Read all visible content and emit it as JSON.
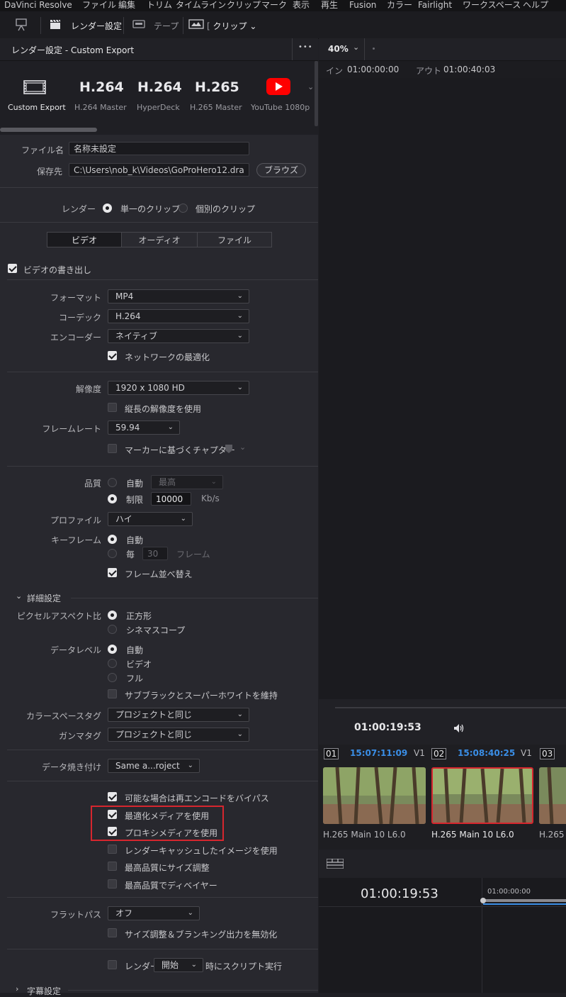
{
  "menubar": {
    "app": "DaVinci Resolve",
    "items": [
      "ファイル",
      "編集",
      "トリム",
      "タイムライン",
      "クリップ",
      "マーク",
      "表示",
      "再生",
      "Fusion",
      "カラー",
      "Fairlight",
      "ワークスペース",
      "ヘルプ"
    ]
  },
  "toolbar": {
    "render_settings": "レンダー設定",
    "tape": "テープ",
    "clip": "クリップ"
  },
  "panel": {
    "title": "レンダー設定 - Custom Export",
    "more": "•••"
  },
  "presets": [
    {
      "big": "",
      "name": "Custom Export",
      "icon": "film-icon"
    },
    {
      "big": "H.264",
      "name": "H.264 Master"
    },
    {
      "big": "H.264",
      "name": "HyperDeck"
    },
    {
      "big": "H.265",
      "name": "H.265 Master"
    },
    {
      "big": "",
      "name": "YouTube 1080p",
      "icon": "youtube-icon"
    }
  ],
  "file": {
    "filename_label": "ファイル名",
    "filename_value": "名称未設定",
    "location_label": "保存先",
    "location_value": "C:\\Users\\nob_k\\Videos\\GoProHero12.dra",
    "browse": "ブラウズ"
  },
  "render_mode": {
    "label": "レンダー",
    "single": "単一のクリップ",
    "individual": "個別のクリップ"
  },
  "tabs": [
    "ビデオ",
    "オーディオ",
    "ファイル"
  ],
  "video": {
    "export_video": "ビデオの書き出し",
    "format_label": "フォーマット",
    "format": "MP4",
    "codec_label": "コーデック",
    "codec": "H.264",
    "encoder_label": "エンコーダー",
    "encoder": "ネイティブ",
    "network_opt": "ネットワークの最適化",
    "resolution_label": "解像度",
    "resolution": "1920 x 1080 HD",
    "vertical_res": "縦長の解像度を使用",
    "framerate_label": "フレームレート",
    "framerate": "59.94",
    "marker_chapters": "マーカーに基づくチャプター",
    "quality_label": "品質",
    "auto": "自動",
    "auto_value": "最高",
    "limit": "制限",
    "limit_value": "10000",
    "kbps": "Kb/s",
    "profile_label": "プロファイル",
    "profile": "ハイ",
    "keyframe_label": "キーフレーム",
    "keyframe_auto": "自動",
    "keyframe_every": "毎",
    "keyframe_every_value": "30",
    "keyframe_frames": "フレーム",
    "frame_reorder": "フレーム並べ替え"
  },
  "advanced": {
    "title": "詳細設定",
    "pixel_aspect_label": "ピクセルアスペクト比",
    "square": "正方形",
    "cinemascope": "シネマスコープ",
    "data_levels_label": "データレベル",
    "dl_auto": "自動",
    "dl_video": "ビデオ",
    "dl_full": "フル",
    "retain_sub": "サブブラックとスーパーホワイトを維持",
    "color_space_label": "カラースペースタグ",
    "color_space": "プロジェクトと同じ",
    "gamma_label": "ガンマタグ",
    "gamma": "プロジェクトと同じ",
    "data_burn_label": "データ焼き付け",
    "data_burn": "Same a...roject",
    "bypass_reencode": "可能な場合は再エンコードをバイパス",
    "use_optimized": "最適化メディアを使用",
    "use_proxy": "プロキシメディアを使用",
    "render_cache": "レンダーキャッシュしたイメージを使用",
    "max_quality_resize": "最高品質にサイズ調整",
    "max_quality_debayer": "最高品質でディベイヤー",
    "flat_pass_label": "フラットパス",
    "flat_pass": "オフ",
    "disable_sizing": "サイズ調整＆ブランキング出力を無効化",
    "script_render": "レンダー",
    "script_start": "開始",
    "script_suffix": "時にスクリプト実行",
    "subtitles": "字幕設定"
  },
  "viewer": {
    "zoom": "40%",
    "in_label": "イン",
    "in_tc": "01:00:00:00",
    "out_label": "アウト",
    "out_tc": "01:00:40:03",
    "timecode": "01:00:19:53"
  },
  "clips": [
    {
      "num": "01",
      "tc": "15:07:11:09",
      "track": "V1",
      "name": "H.265 Main 10 L6.0"
    },
    {
      "num": "02",
      "tc": "15:08:40:25",
      "track": "V1",
      "name": "H.265 Main 10 L6.0"
    },
    {
      "num": "03",
      "tc": "",
      "track": "",
      "name": "H.265"
    }
  ],
  "timeline": {
    "timecode": "01:00:19:53",
    "ruler_start": "01:00:00:00"
  },
  "colors": {
    "accent_blue": "#3a8ee6",
    "highlight_red": "#d6262e",
    "youtube_red": "#ff0000"
  }
}
